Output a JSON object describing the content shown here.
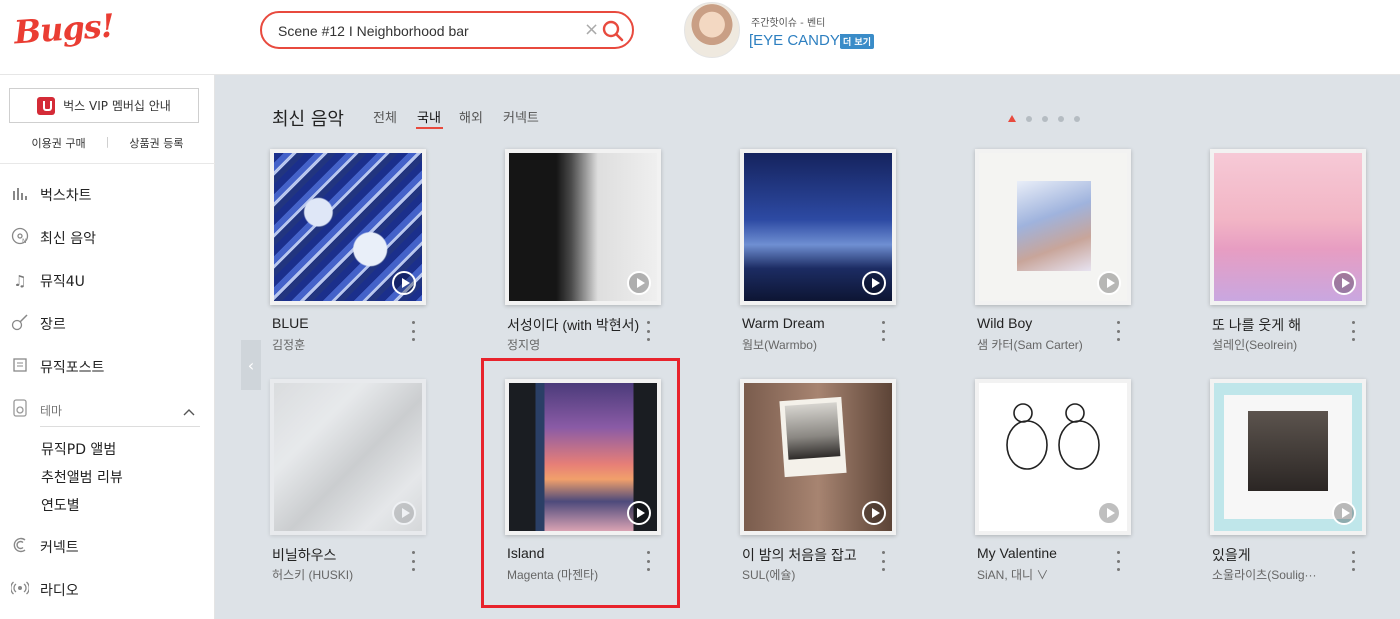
{
  "header": {
    "logo": "Bugs!",
    "search_value": "Scene #12 I Neighborhood bar",
    "search_clear": "×",
    "issue_label": "주간핫이슈 - 벤티",
    "issue_title": "[EYE CANDY]",
    "issue_more": "더 보기"
  },
  "sidebar": {
    "vip_label": "벅스 VIP 멤버십 안내",
    "links": [
      "이용권 구매",
      "상품권 등록"
    ],
    "nav": [
      {
        "label": "벅스차트",
        "icon": "chart-icon"
      },
      {
        "label": "최신 음악",
        "icon": "new-music-icon"
      },
      {
        "label": "뮤직4U",
        "icon": "music-note-icon"
      },
      {
        "label": "장르",
        "icon": "guitar-icon"
      },
      {
        "label": "뮤직포스트",
        "icon": "post-icon"
      },
      {
        "label": "테마",
        "icon": "theme-icon"
      },
      {
        "label": "커넥트",
        "icon": "connect-icon"
      },
      {
        "label": "라디오",
        "icon": "radio-icon"
      }
    ],
    "theme_sub": [
      "뮤직PD 앨범",
      "추천앨범 리뷰",
      "연도별"
    ]
  },
  "main": {
    "section_title": "최신 음악",
    "tabs": [
      "전체",
      "국내",
      "해외",
      "커넥트"
    ],
    "active_tab": "국내",
    "albums": [
      {
        "title": "BLUE",
        "artist": "김정훈"
      },
      {
        "title": "서성이다 (with 박현서)",
        "artist": "정지영"
      },
      {
        "title": "Warm Dream",
        "artist": "웜보(Warmbo)"
      },
      {
        "title": "Wild Boy",
        "artist": "샘 카터(Sam Carter)"
      },
      {
        "title": "또 나를 웃게 해",
        "artist": "설레인(Seolrein)"
      },
      {
        "title": "비닐하우스",
        "artist": "허스키 (HUSKI)"
      },
      {
        "title": "Island",
        "artist": "Magenta (마젠타)"
      },
      {
        "title": "이 밤의 처음을 잡고",
        "artist": "SUL(에슐)"
      },
      {
        "title": "My Valentine",
        "artist": "SiAN, 대니 ∨"
      },
      {
        "title": "있을게",
        "artist": "소울라이츠(Soulig···"
      }
    ]
  },
  "colors": {
    "accent": "#e84a3e",
    "link": "#2d7fc0",
    "highlight": "#e8232c"
  }
}
